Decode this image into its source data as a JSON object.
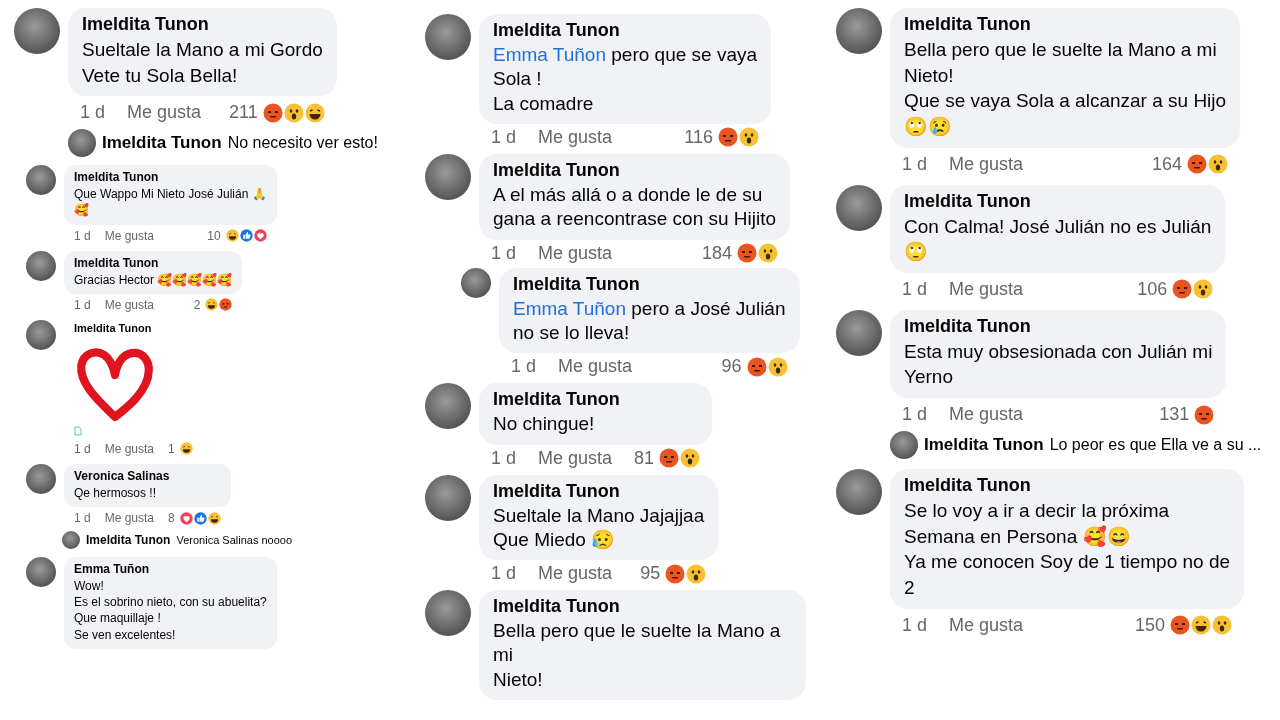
{
  "columns": [
    {
      "sections": [
        {
          "kind": "regular",
          "items": [
            {
              "kind": "comment",
              "author": "Imeldita Tunon",
              "text": "Sueltale la Mano a mi Gordo\nVete tu Sola Bella!",
              "time": "1 d",
              "like": "Me gusta",
              "count": "211",
              "reactions": [
                {
                  "kind": "angry"
                },
                {
                  "kind": "wow"
                },
                {
                  "kind": "haha"
                }
              ],
              "replies": [
                {
                  "kind": "preview",
                  "author": "Imeldita Tunon",
                  "text": "No necesito ver esto!"
                }
              ]
            }
          ]
        },
        {
          "kind": "compact",
          "items": [
            {
              "kind": "comment",
              "author": "Imeldita Tunon",
              "text": "Que Wappo Mi Nieto José Julián 🙏\n🥰",
              "time": "1 d",
              "like": "Me gusta",
              "count": "10",
              "reactions": [
                {
                  "kind": "haha"
                },
                {
                  "kind": "like"
                },
                {
                  "kind": "love"
                }
              ]
            },
            {
              "kind": "comment",
              "author": "Imeldita Tunon",
              "text": "Gracias Hector 🥰🥰🥰🥰🥰",
              "time": "1 d",
              "like": "Me gusta",
              "count": "2",
              "reactions": [
                {
                  "kind": "haha"
                },
                {
                  "kind": "angry"
                }
              ]
            },
            {
              "kind": "sticker",
              "author": "Imeldita Tunon",
              "time": "1 d",
              "like": "Me gusta",
              "count": "1",
              "reactions": [
                {
                  "kind": "haha"
                }
              ]
            },
            {
              "kind": "comment",
              "author": "Veronica Salinas",
              "text": "Qe hermosos !!",
              "time": "1 d",
              "like": "Me gusta",
              "count": "8",
              "reactions": [
                {
                  "kind": "love"
                },
                {
                  "kind": "like"
                },
                {
                  "kind": "haha"
                }
              ],
              "replies": [
                {
                  "kind": "preview",
                  "author": "Imeldita Tunon",
                  "text": "Veronica Salinas noooo"
                }
              ]
            },
            {
              "kind": "comment",
              "author": "Emma Tuñon",
              "text": "Wow!\nEs el sobrino nieto, con su abuelita?\nQue maquillaje !\nSe ven excelentes!"
            }
          ]
        }
      ]
    },
    {
      "sections": [
        {
          "kind": "regular",
          "items": [
            {
              "kind": "comment",
              "author": "Imeldita Tunon",
              "mention": "Emma Tuñon",
              "text": "pero que se vaya\nSola !\nLa comadre",
              "time": "1 d",
              "like": "Me gusta",
              "count": "116",
              "reactions": [
                {
                  "kind": "angry"
                },
                {
                  "kind": "wow"
                }
              ]
            },
            {
              "kind": "comment",
              "author": "Imeldita Tunon",
              "text": "A el más allá o a donde le de su\ngana a reencontrase con su Hijito",
              "time": "1 d",
              "like": "Me gusta",
              "count": "184",
              "reactions": [
                {
                  "kind": "angry"
                },
                {
                  "kind": "wow"
                }
              ],
              "replies": [
                {
                  "kind": "comment",
                  "author": "Imeldita Tunon",
                  "mention": "Emma Tuñon",
                  "text": "pero a José Julián\nno se lo lleva!",
                  "time": "1 d",
                  "like": "Me gusta",
                  "count": "96",
                  "reactions": [
                    {
                      "kind": "angry"
                    },
                    {
                      "kind": "wow"
                    }
                  ]
                }
              ]
            },
            {
              "kind": "comment",
              "author": "Imeldita Tunon",
              "text": "No chingue!",
              "time": "1 d",
              "like": "Me gusta",
              "count": "81",
              "reactions": [
                {
                  "kind": "angry"
                },
                {
                  "kind": "wow"
                }
              ]
            },
            {
              "kind": "comment",
              "author": "Imeldita Tunon",
              "text": "Sueltale la Mano Jajajjaa\nQue Miedo 😥",
              "time": "1 d",
              "like": "Me gusta",
              "count": "95",
              "reactions": [
                {
                  "kind": "angry"
                },
                {
                  "kind": "wow"
                }
              ]
            },
            {
              "kind": "comment",
              "author": "Imeldita Tunon",
              "text": "Bella pero que le suelte la Mano a mi\nNieto!"
            }
          ]
        }
      ]
    },
    {
      "sections": [
        {
          "kind": "regular",
          "items": [
            {
              "kind": "comment",
              "author": "Imeldita Tunon",
              "text": "Bella pero que le suelte la Mano a mi\nNieto!\nQue se vaya Sola a alcanzar a su Hijo\n🙄😢",
              "time": "1 d",
              "like": "Me gusta",
              "count": "164",
              "reactions": [
                {
                  "kind": "angry"
                },
                {
                  "kind": "wow"
                }
              ]
            },
            {
              "kind": "comment",
              "author": "Imeldita Tunon",
              "text": "Con Calma! José Julián no es Julián\n🙄",
              "time": "1 d",
              "like": "Me gusta",
              "count": "106",
              "reactions": [
                {
                  "kind": "angry"
                },
                {
                  "kind": "wow"
                }
              ]
            },
            {
              "kind": "comment",
              "author": "Imeldita Tunon",
              "text": "Esta muy obsesionada con Julián mi\nYerno",
              "time": "1 d",
              "like": "Me gusta",
              "count": "131",
              "reactions": [
                {
                  "kind": "angry"
                }
              ],
              "replies": [
                {
                  "kind": "preview",
                  "author": "Imeldita Tunon",
                  "text": "Lo peor es que Ella ve a su ..."
                }
              ]
            },
            {
              "kind": "comment",
              "author": "Imeldita Tunon",
              "text": "Se lo voy a ir a decir la próxima\nSemana en Persona 🥰😄\nYa me conocen Soy de 1 tiempo no de\n2",
              "time": "1 d",
              "like": "Me gusta",
              "count": "150",
              "reactions": [
                {
                  "kind": "angry"
                },
                {
                  "kind": "haha"
                },
                {
                  "kind": "wow"
                }
              ]
            }
          ]
        }
      ]
    }
  ]
}
